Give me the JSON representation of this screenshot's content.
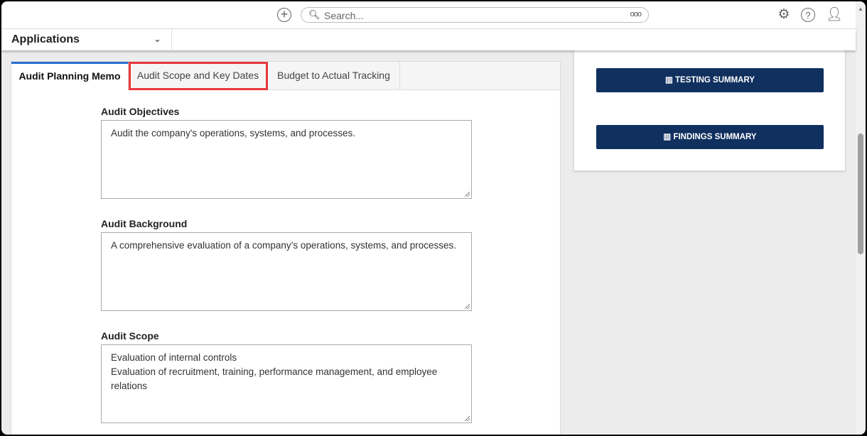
{
  "topbar": {
    "search_placeholder": "Search...",
    "more": "ooo"
  },
  "appbar": {
    "label": "Applications"
  },
  "tabs": [
    {
      "label": "Audit Planning Memo"
    },
    {
      "label": "Audit Scope and Key Dates"
    },
    {
      "label": "Budget to Actual Tracking"
    }
  ],
  "fields": [
    {
      "label": "Audit Objectives",
      "value": "Audit the company's operations, systems, and processes."
    },
    {
      "label": "Audit Background",
      "value": "A comprehensive evaluation of a company’s operations, systems, and processes."
    },
    {
      "label": "Audit Scope",
      "value": "Evaluation of internal controls\nEvaluation of recruitment, training, performance management, and employee relations"
    }
  ],
  "buttons": {
    "testing": "TESTING SUMMARY",
    "findings": "FINDINGS SUMMARY"
  },
  "colors": {
    "button": "#10305f",
    "active_tab": "#2a6ecf",
    "highlight": "#e8373c"
  }
}
